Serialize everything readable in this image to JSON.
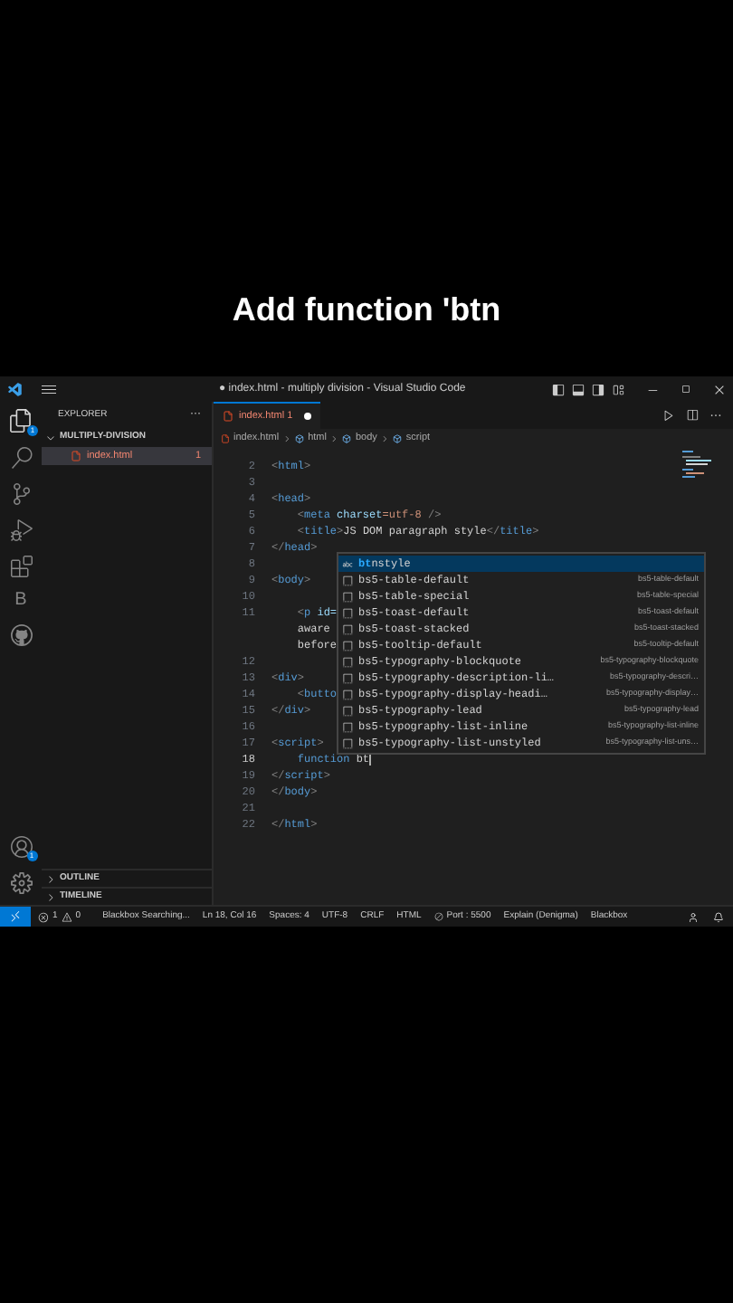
{
  "caption": "Add function 'btn",
  "window": {
    "title": "● index.html - multiply division - Visual Studio Code"
  },
  "activity_bar": {
    "files_badge": "1",
    "blackbox_letter": "B",
    "account_badge": "1"
  },
  "sidebar": {
    "title": "EXPLORER",
    "more": "···",
    "folder": "MULTIPLY-DIVISION",
    "files": [
      {
        "name": "index.html",
        "count": "1",
        "selected": true
      }
    ],
    "sections": [
      "OUTLINE",
      "TIMELINE"
    ]
  },
  "tabs": [
    {
      "label": "index.html",
      "count": "1",
      "selected": true,
      "dirty": true
    }
  ],
  "breadcrumb": [
    "index.html",
    "html",
    "body",
    "script"
  ],
  "code_lines": [
    {
      "number": "2",
      "current": false,
      "segments": [
        {
          "text": "<html>",
          "kind": "tag"
        }
      ]
    },
    {
      "number": "3",
      "current": false
    },
    {
      "number": "4",
      "current": false,
      "segments": [
        {
          "text": "<head>",
          "kind": "tag"
        }
      ]
    },
    {
      "number": "5",
      "current": false,
      "segments": [
        {
          "text": "    <meta ",
          "kind": "tag"
        },
        {
          "text": "charset",
          "kind": "attr"
        },
        {
          "text": "=utf-8 ",
          "kind": "value"
        },
        {
          "text": "/>",
          "kind": "tag"
        }
      ]
    },
    {
      "number": "6",
      "current": false,
      "segments": [
        {
          "text": "    <title>",
          "kind": "tag"
        },
        {
          "text": "JS DOM paragraph style",
          "kind": "plain"
        },
        {
          "text": "</title>",
          "kind": "tag"
        }
      ]
    },
    {
      "number": "7",
      "current": false,
      "segments": [
        {
          "text": "</head>",
          "kind": "tag"
        }
      ]
    },
    {
      "number": "8",
      "current": false
    },
    {
      "number": "9",
      "current": false,
      "segments": [
        {
          "text": "<body>",
          "kind": "tag"
        }
      ]
    },
    {
      "number": "10",
      "current": false
    },
    {
      "number": "11",
      "current": false,
      "segments": [
        {
          "text": "    <p ",
          "kind": "tag"
        },
        {
          "text": "id=",
          "kind": "attr"
        }
      ],
      "wrap": [
        "    aware",
        "    before"
      ]
    },
    {
      "number": "12",
      "current": false
    },
    {
      "number": "13",
      "current": false,
      "segments": [
        {
          "text": "<div>",
          "kind": "tag"
        }
      ]
    },
    {
      "number": "14",
      "current": false,
      "segments": [
        {
          "text": "    <butto",
          "kind": "tag"
        }
      ]
    },
    {
      "number": "15",
      "current": false,
      "segments": [
        {
          "text": "</div>",
          "kind": "tag"
        }
      ]
    },
    {
      "number": "16",
      "current": false
    },
    {
      "number": "17",
      "current": false,
      "segments": [
        {
          "text": "<script>",
          "kind": "tag"
        }
      ]
    },
    {
      "number": "18",
      "current": true,
      "segments": [
        {
          "text": "    function",
          "kind": "keyword"
        },
        {
          "text": " bt",
          "kind": "plain"
        }
      ]
    },
    {
      "number": "19",
      "current": false,
      "segments": [
        {
          "text": "</script>",
          "kind": "tag"
        }
      ]
    },
    {
      "number": "20",
      "current": false,
      "segments": [
        {
          "text": "</body>",
          "kind": "tag"
        }
      ]
    },
    {
      "number": "21",
      "current": false
    },
    {
      "number": "22",
      "current": false,
      "segments": [
        {
          "text": "</html>",
          "kind": "tag"
        }
      ]
    }
  ],
  "suggestions": [
    {
      "kind": "word",
      "match": "bt",
      "label": "nstyle",
      "selected": true
    },
    {
      "kind": "snippet",
      "label": "bs5-table-default",
      "detail": "bs5-table-default",
      "selected": false
    },
    {
      "kind": "snippet",
      "label": "bs5-table-special",
      "detail": "bs5-table-special",
      "selected": false
    },
    {
      "kind": "snippet",
      "label": "bs5-toast-default",
      "detail": "bs5-toast-default",
      "selected": false
    },
    {
      "kind": "snippet",
      "label": "bs5-toast-stacked",
      "detail": "bs5-toast-stacked",
      "selected": false
    },
    {
      "kind": "snippet",
      "label": "bs5-tooltip-default",
      "detail": "bs5-tooltip-default",
      "selected": false
    },
    {
      "kind": "snippet",
      "label": "bs5-typography-blockquote",
      "detail": "bs5-typography-blockquote",
      "selected": false
    },
    {
      "kind": "snippet",
      "label": "bs5-typography-description-li…",
      "detail": "bs5-typography-descri…",
      "selected": false
    },
    {
      "kind": "snippet",
      "label": "bs5-typography-display-headi…",
      "detail": "bs5-typography-display…",
      "selected": false
    },
    {
      "kind": "snippet",
      "label": "bs5-typography-lead",
      "detail": "bs5-typography-lead",
      "selected": false
    },
    {
      "kind": "snippet",
      "label": "bs5-typography-list-inline",
      "detail": "bs5-typography-list-inline",
      "selected": false
    },
    {
      "kind": "snippet",
      "label": "bs5-typography-list-unstyled",
      "detail": "bs5-typography-list-uns…",
      "selected": false
    }
  ],
  "status_bar": {
    "errors": "1",
    "warnings": "0",
    "items": [
      {
        "kind": "text",
        "text": "Blackbox Searching..."
      },
      {
        "kind": "text",
        "text": "Ln 18, Col 16"
      },
      {
        "kind": "text",
        "text": "Spaces: 4"
      },
      {
        "kind": "text",
        "text": "UTF-8"
      },
      {
        "kind": "text",
        "text": "CRLF"
      },
      {
        "kind": "text",
        "text": "HTML"
      },
      {
        "kind": "port",
        "text": "Port : 5500"
      },
      {
        "kind": "text",
        "text": "Explain (Denigma)"
      },
      {
        "kind": "text",
        "text": "Blackbox"
      }
    ]
  }
}
